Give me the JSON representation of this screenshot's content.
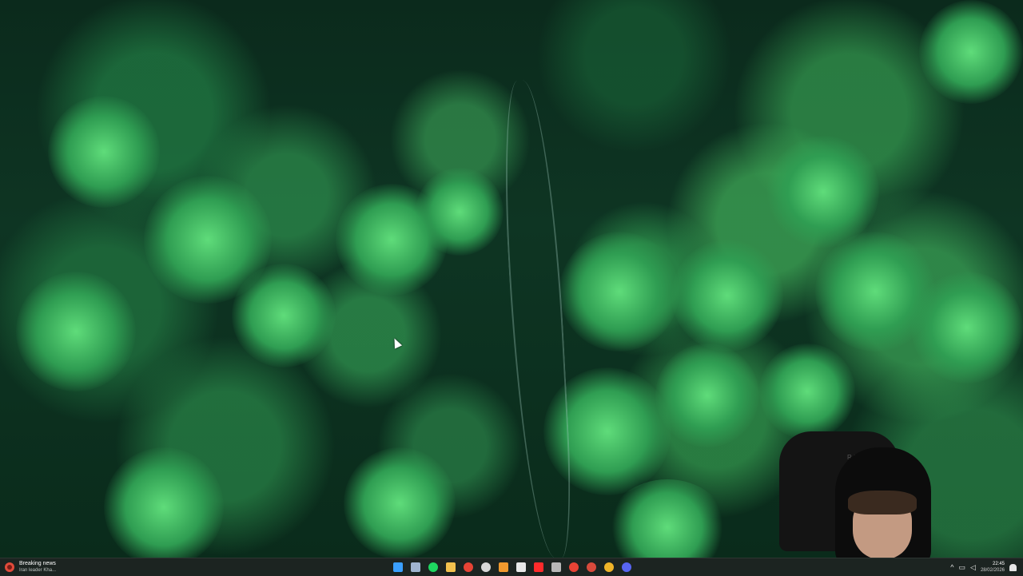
{
  "taskbar": {
    "news_widget": {
      "title": "Breaking news",
      "subtitle": "Iran leader Kha..."
    },
    "apps": [
      {
        "icon": "windows-start-icon",
        "color": "#3aa0ff"
      },
      {
        "icon": "steam-icon",
        "color": "#9fb4cf"
      },
      {
        "icon": "spotify-icon",
        "color": "#1ed760"
      },
      {
        "icon": "file-explorer-icon",
        "color": "#f2c14e"
      },
      {
        "icon": "chrome-icon",
        "color": "#e84335"
      },
      {
        "icon": "obs-icon",
        "color": "#d9d9d9"
      },
      {
        "icon": "app-orange-icon",
        "color": "#f29a2e"
      },
      {
        "icon": "calendar-icon",
        "color": "#e8e8e8"
      },
      {
        "icon": "youtube-icon",
        "color": "#ff2b2b"
      },
      {
        "icon": "settings-icon",
        "color": "#b8b8b8"
      },
      {
        "icon": "chrome-profile-icon",
        "color": "#e84335"
      },
      {
        "icon": "chrome-dev-icon",
        "color": "#d94a3c"
      },
      {
        "icon": "chrome-canary-icon",
        "color": "#f0b429"
      },
      {
        "icon": "discord-icon",
        "color": "#5865f2"
      }
    ],
    "tray": {
      "time": "22:45",
      "date": "28/02/2026"
    }
  },
  "webcam": {
    "chair_brand": "RA"
  }
}
